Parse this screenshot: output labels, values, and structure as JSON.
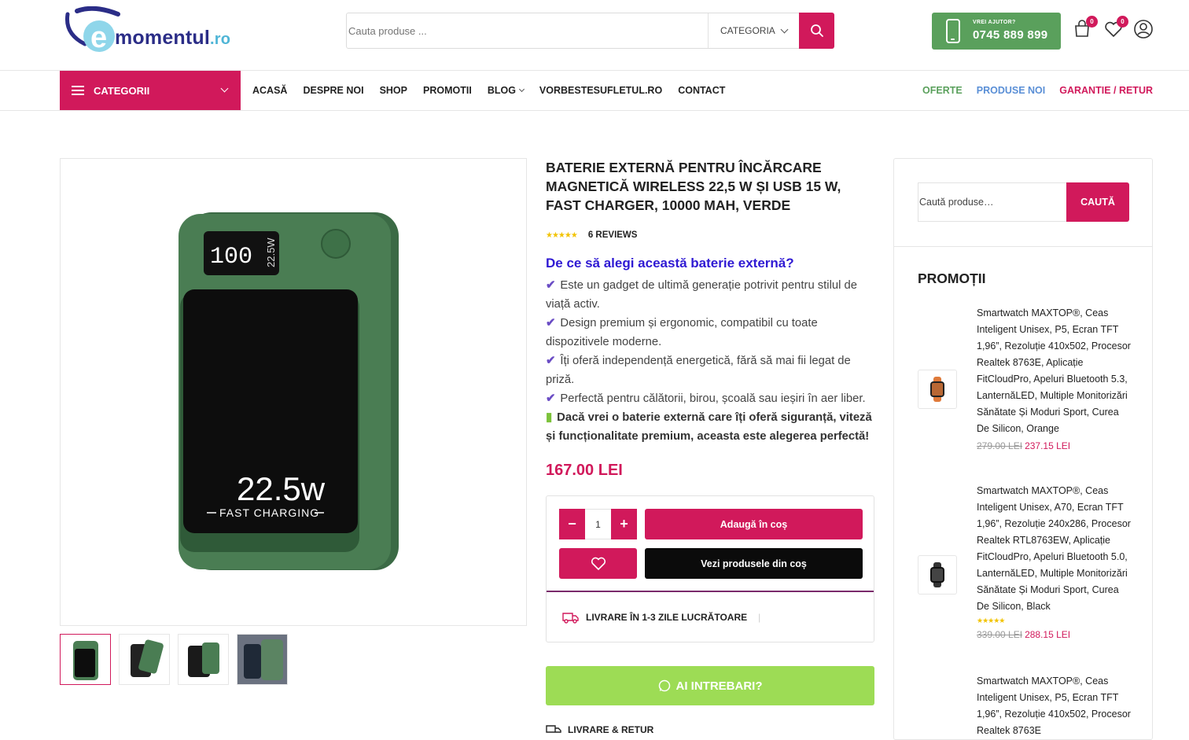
{
  "header": {
    "logo": {
      "text_e": "e",
      "text_main": "momentul",
      "text_tld": ".ro"
    },
    "search": {
      "placeholder": "Cauta produse ...",
      "category_label": "CATEGORIA"
    },
    "help": {
      "small_label": "VREI AJUTOR?",
      "phone": "0745 889 899"
    },
    "cart_count": "0",
    "wishlist_count": "0",
    "colors": {
      "accent": "#d1195b",
      "green": "#5aa05c"
    }
  },
  "nav": {
    "categories_label": "CATEGORII",
    "items": [
      {
        "label": "ACASĂ"
      },
      {
        "label": "DESPRE NOI"
      },
      {
        "label": "SHOP"
      },
      {
        "label": "PROMOTII"
      },
      {
        "label": "BLOG"
      },
      {
        "label": "VORBESTESUFLETUL.RO"
      },
      {
        "label": "CONTACT"
      }
    ],
    "right_links": [
      {
        "label": "OFERTE",
        "color": "#5aa05c"
      },
      {
        "label": "PRODUSE NOI",
        "color": "#5a8fd6"
      },
      {
        "label": "GARANTIE / RETUR",
        "color": "#d1195b"
      }
    ]
  },
  "product": {
    "title": "Baterie externă pentru încărcare magnetică wireless 22,5 W și USB 15 W, fast charger, 10000 mAh, verde",
    "reviews": "6 REVIEWS",
    "why_heading": "De ce să alegi această baterie externă?",
    "bullets": [
      "Este un gadget de ultimă generație potrivit pentru stilul de viață activ.",
      "Design premium și ergonomic, compatibil cu toate dispozitivele moderne.",
      "Îți oferă independență energetică, fără să mai fii legat de priză.",
      "Perfectă pentru călătorii, birou, școală sau ieșiri în aer liber."
    ],
    "closing": "Dacă vrei o baterie externă care îți oferă siguranță, viteză și funcționalitate premium, aceasta este alegerea perfectă!",
    "price": "167.00 LEI",
    "image_texts": {
      "display": "100",
      "badge": "22.5W",
      "watt": "22.5w",
      "caption": "FAST CHARGING"
    },
    "quantity": "1",
    "add_to_cart": "Adaugă în coș",
    "view_cart": "Vezi produsele din coș",
    "delivery": "LIVRARE ÎN 1-3 ZILE LUCRĂTOARE",
    "whatsapp": "AI INTREBARI?",
    "returns": "LIVRARE & RETUR"
  },
  "sidebar": {
    "search_placeholder": "Caută produse…",
    "search_button": "CAUTĂ",
    "promo_title": "PROMOȚII",
    "promos": [
      {
        "name": "Smartwatch MAXTOP®, Ceas Inteligent Unisex, P5, Ecran TFT 1,96”, Rezoluție 410x502, Procesor Realtek 8763E, Aplicație FitCloudPro, Apeluri Bluetooth 5.3, LanternăLED, Multiple Monitorizări Sănătate Și Moduri Sport, Curea De Silicon, Orange",
        "old_price": "279.00 LEI",
        "new_price": "237.15 LEI"
      },
      {
        "name": "Smartwatch MAXTOP®, Ceas Inteligent Unisex, A70, Ecran TFT 1,96”, Rezoluție 240x286, Procesor Realtek RTL8763EW, Aplicație FitCloudPro, Apeluri Bluetooth 5.0, LanternăLED, Multiple Monitorizări Sănătate Și Moduri Sport, Curea De Silicon, Black",
        "old_price": "339.00 LEI",
        "new_price": "288.15 LEI"
      },
      {
        "name": "Smartwatch MAXTOP®, Ceas Inteligent Unisex, P5, Ecran TFT 1,96”, Rezoluție 410x502, Procesor Realtek 8763E"
      }
    ]
  }
}
